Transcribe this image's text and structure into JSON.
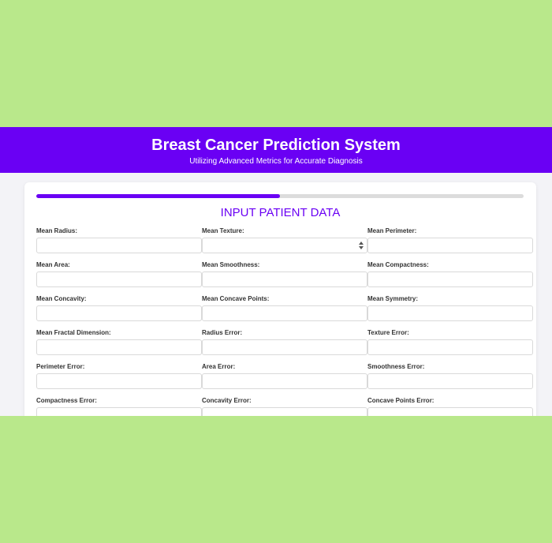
{
  "app": {
    "title": "Breast Cancer Prediction System",
    "subtitle": "Utilizing Advanced Metrics for Accurate Diagnosis"
  },
  "form": {
    "section_title": "INPUT PATIENT DATA",
    "progress_fraction": 0.5,
    "fields": [
      {
        "label": "Mean Radius:",
        "value": ""
      },
      {
        "label": "Mean Texture:",
        "value": ""
      },
      {
        "label": "Mean Perimeter:",
        "value": ""
      },
      {
        "label": "Mean Area:",
        "value": ""
      },
      {
        "label": "Mean Smoothness:",
        "value": ""
      },
      {
        "label": "Mean Compactness:",
        "value": ""
      },
      {
        "label": "Mean Concavity:",
        "value": ""
      },
      {
        "label": "Mean Concave Points:",
        "value": ""
      },
      {
        "label": "Mean Symmetry:",
        "value": ""
      },
      {
        "label": "Mean Fractal Dimension:",
        "value": ""
      },
      {
        "label": "Radius Error:",
        "value": ""
      },
      {
        "label": "Texture Error:",
        "value": ""
      },
      {
        "label": "Perimeter Error:",
        "value": ""
      },
      {
        "label": "Area Error:",
        "value": ""
      },
      {
        "label": "Smoothness Error:",
        "value": ""
      },
      {
        "label": "Compactness Error:",
        "value": ""
      },
      {
        "label": "Concavity Error:",
        "value": ""
      },
      {
        "label": "Concave Points Error:",
        "value": ""
      }
    ]
  },
  "colors": {
    "accent": "#6a00f4",
    "outer_background": "#b9e88b",
    "page_background": "#f3f3f7"
  }
}
